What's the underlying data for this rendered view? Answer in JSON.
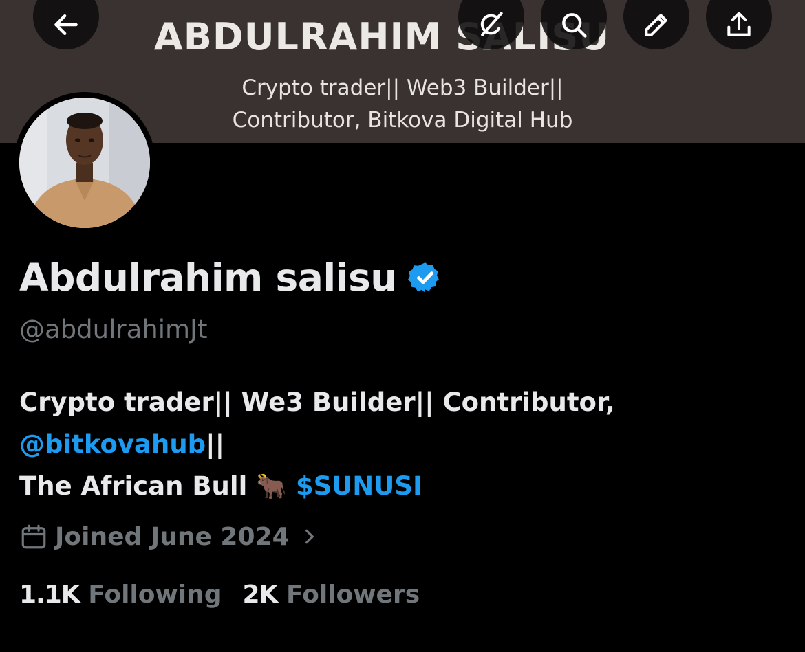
{
  "banner": {
    "title": "ABDULRAHIM SALISU",
    "subtitle_line1": "Crypto trader|| Web3 Builder||",
    "subtitle_line2": "Contributor, Bitkova Digital Hub"
  },
  "nav": {
    "back_icon": "arrow-left-icon",
    "grok_icon": "grok-icon",
    "search_icon": "search-icon",
    "edit_icon": "pencil-icon",
    "share_icon": "share-icon"
  },
  "profile": {
    "display_name": "Abdulrahim salisu",
    "verified_icon": "verified-badge-icon",
    "handle": "@abdulrahimJt",
    "bio_line1": "Crypto trader|| We3 Builder|| Contributor,",
    "bio_mention": "@bitkovahub",
    "bio_mention_suffix": "||",
    "bio_line3_text": "The African Bull ",
    "bio_emoji": "🐂",
    "bio_cashtag": "$SUNUSI",
    "joined": "Joined June 2024",
    "following_count": "1.1K",
    "following_label": "Following",
    "followers_count": "2K",
    "followers_label": "Followers"
  },
  "colors": {
    "banner_bg": "#3a3230",
    "page_bg": "#000000",
    "link": "#1d9bf0",
    "muted": "#71767b",
    "text": "#e7e9ea"
  }
}
